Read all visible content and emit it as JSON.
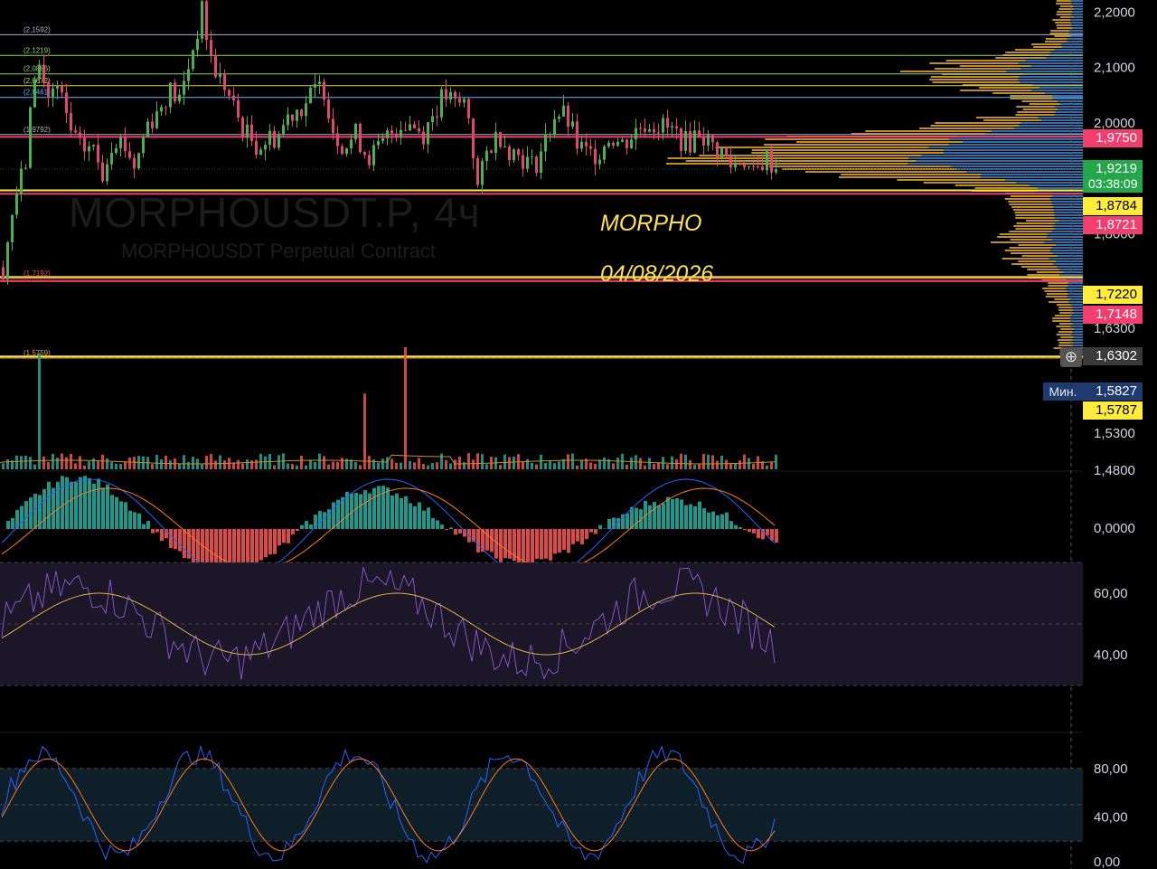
{
  "chart_data": {
    "type": "candlestick",
    "symbol_watermark": "MORPHOUSDT.P, 4ч",
    "symbol_description": "MORPHOUSDT Perpetual Contract",
    "annotations": [
      {
        "text": "MORPHO"
      },
      {
        "text": "04/08/2026"
      }
    ],
    "price_axis": {
      "ticks": [
        "2,2000",
        "2,1000",
        "2,0000",
        "1,8000",
        "1,6300",
        "1,5300",
        "1,4800"
      ],
      "tick_values": [
        2.2,
        2.1,
        2.0,
        1.8,
        1.63,
        1.53,
        1.48
      ]
    },
    "price_tags": [
      {
        "value": "1,9750",
        "bg": "#f23d6d",
        "fg": "#ffffff"
      },
      {
        "value": "1,9219",
        "sub": "03:38:09",
        "bg": "#26a64a",
        "fg": "#ffffff"
      },
      {
        "value": "1,8784",
        "bg": "#ffeb3b",
        "fg": "#000000"
      },
      {
        "value": "1,8721",
        "bg": "#f23d6d",
        "fg": "#ffffff"
      },
      {
        "value": "1,7220",
        "bg": "#ffeb3b",
        "fg": "#000000"
      },
      {
        "value": "1,7148",
        "bg": "#f23d6d",
        "fg": "#ffffff"
      },
      {
        "value": "1,6302",
        "bg": "#3a3a3a",
        "fg": "#ffffff"
      },
      {
        "value": "1,5827",
        "bg": "#1e3a6e",
        "fg": "#ffffff"
      },
      {
        "value": "1,5787",
        "bg": "#ffeb3b",
        "fg": "#000000"
      }
    ],
    "min_label": "Мин.",
    "fib_levels": [
      {
        "label": "(2,1592)",
        "value": 2.1592,
        "color": "#b0b0c8"
      },
      {
        "label": "(2,1219)",
        "value": 2.1219,
        "color": "#8fd36b"
      },
      {
        "label": "(2,0886)",
        "value": 2.0886,
        "color": "#8fd36b"
      },
      {
        "label": "(2,0672)",
        "value": 2.0672,
        "color": "#d4d44a"
      },
      {
        "label": "(2,0461)",
        "value": 2.0461,
        "color": "#5fb6ff"
      },
      {
        "label": "(1,9792)",
        "value": 1.9792,
        "color": "#b0b0c8"
      },
      {
        "label": "(1,7192)",
        "value": 1.7192,
        "color": "#e64a6a"
      },
      {
        "label": "(1,5759)",
        "value": 1.5759,
        "color": "#e6a040"
      }
    ],
    "horizontal_lines": [
      {
        "value": 1.975,
        "color": "#f23d6d"
      },
      {
        "value": 1.8784,
        "color": "#ffeb3b"
      },
      {
        "value": 1.8721,
        "color": "#f23d6d"
      },
      {
        "value": 1.722,
        "color": "#ffeb3b"
      },
      {
        "value": 1.7148,
        "color": "#f23d6d"
      },
      {
        "value": 1.5787,
        "color": "#ffeb3b"
      }
    ],
    "close_path": [
      1.74,
      1.86,
      1.92,
      2.12,
      2.05,
      2.06,
      1.99,
      1.95,
      1.96,
      1.91,
      1.98,
      1.96,
      1.92,
      2.0,
      2.02,
      2.06,
      2.04,
      2.12,
      2.2,
      2.1,
      2.07,
      2.02,
      1.98,
      1.96,
      1.97,
      1.98,
      2.02,
      2.03,
      2.05,
      2.07,
      1.98,
      1.96,
      1.98,
      1.94,
      1.95,
      1.98,
      2.0,
      2.0,
      1.98,
      2.02,
      2.05,
      2.03,
      2.04,
      1.88,
      1.96,
      1.98,
      1.95,
      1.94,
      1.92,
      1.96,
      2.02,
      2.01,
      1.96,
      1.94,
      1.95,
      1.98,
      1.96,
      1.98,
      2.0,
      2.0,
      1.99,
      1.98,
      1.96,
      1.99,
      1.96,
      1.95,
      1.92,
      1.94,
      1.9,
      1.94,
      1.92
    ],
    "volume_peaks": [
      {
        "index": 8,
        "rel": 0.95
      },
      {
        "index": 80,
        "rel": 0.62
      },
      {
        "index": 89,
        "rel": 1.0
      }
    ],
    "macd": {
      "zero_label": "0,0000"
    },
    "rsi": {
      "ticks": [
        "60,00",
        "40,00"
      ],
      "tick_values": [
        60,
        40
      ]
    },
    "stoch": {
      "ticks": [
        "80,00",
        "40,00",
        "0,00"
      ],
      "tick_values": [
        80,
        40,
        0
      ]
    },
    "colors": {
      "up": "#26a69a",
      "down": "#ef5350",
      "candle_up": "#4caf50",
      "candle_down": "#e0466e",
      "vp_yellow": "#e0a820",
      "vp_blue": "#2a6db0",
      "rsi_line": "#7e57c2",
      "rsi_ma": "#e0b040",
      "stoch_k": "#2962ff",
      "stoch_d": "#ff7a1a"
    }
  }
}
